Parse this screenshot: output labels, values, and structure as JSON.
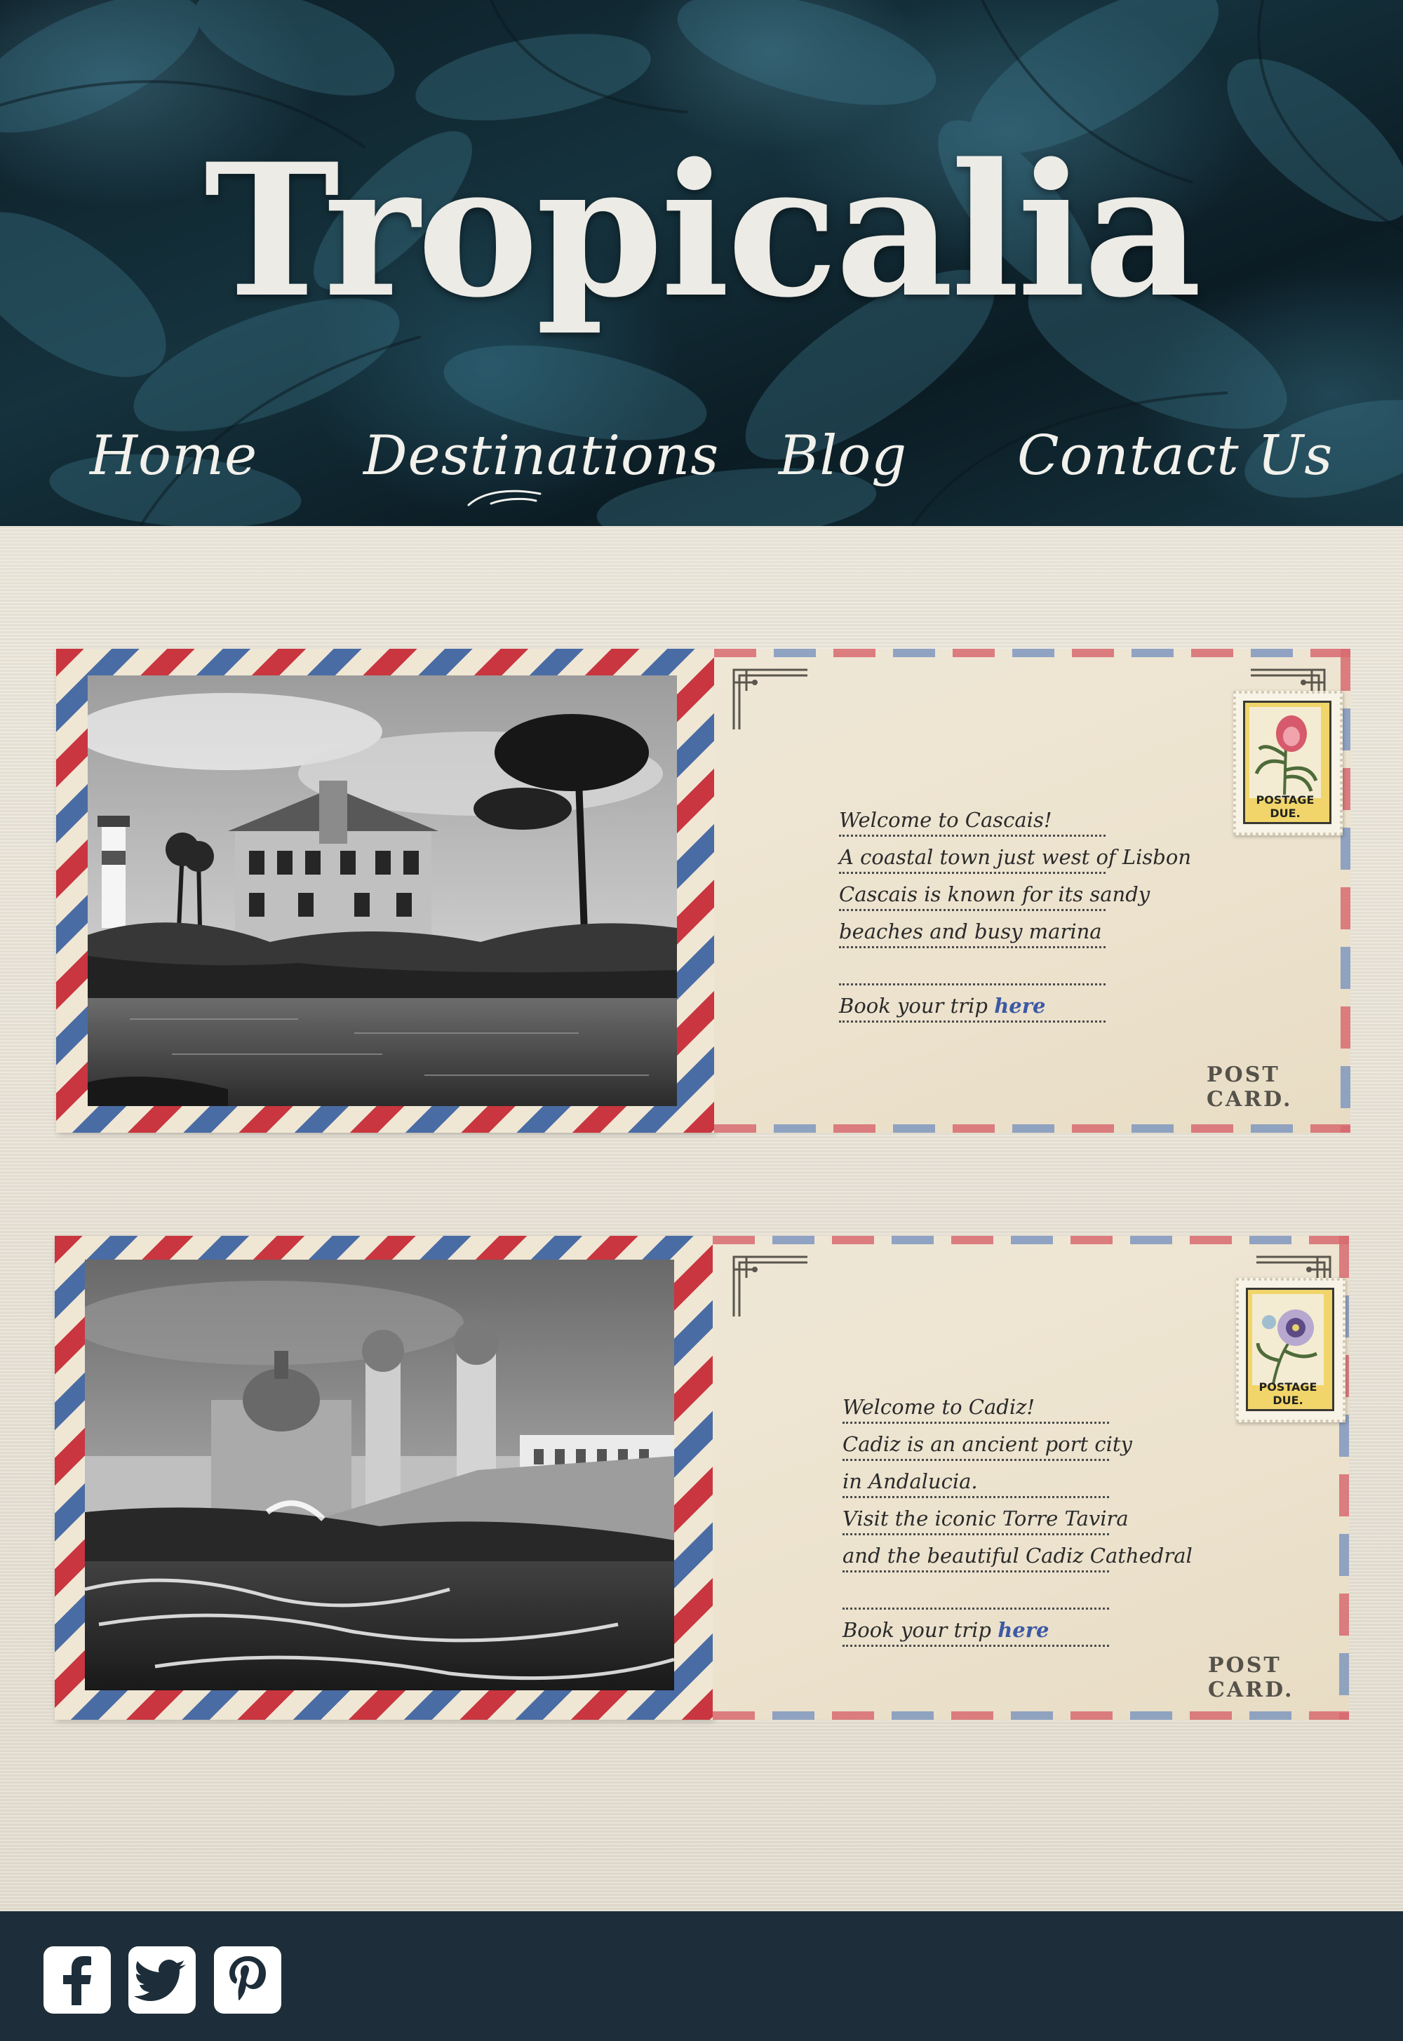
{
  "header": {
    "brand": "Tropicalia",
    "nav": [
      {
        "label": "Home"
      },
      {
        "label": "Destinations",
        "active": true
      },
      {
        "label": "Blog"
      },
      {
        "label": "Contact Us"
      }
    ]
  },
  "postcards": [
    {
      "lines": [
        "Welcome to Cascais!",
        "A coastal town just west of Lisbon",
        "Cascais is known for its sandy",
        "beaches and busy marina",
        ""
      ],
      "book_text": "Book your trip ",
      "book_link": "here",
      "stamp_label": "POSTAGE DUE.",
      "postcard_label": "POST CARD."
    },
    {
      "lines": [
        "Welcome to Cadiz!",
        "Cadiz is an ancient port city",
        "in Andalucia.",
        "Visit the iconic  Torre Tavira",
        "and the beautiful Cadiz Cathedral",
        ""
      ],
      "book_text": "Book your trip ",
      "book_link": "here",
      "stamp_label": "POSTAGE DUE.",
      "postcard_label": "POST CARD."
    }
  ],
  "footer": {
    "social": [
      "facebook-icon",
      "twitter-icon",
      "pinterest-icon"
    ]
  },
  "colors": {
    "stripe_red": "#c9363f",
    "stripe_blue": "#4a6ca4",
    "link_blue": "#3c59a5",
    "footer_bg": "#1d2e3a",
    "page_bg": "#e6e0d2"
  }
}
